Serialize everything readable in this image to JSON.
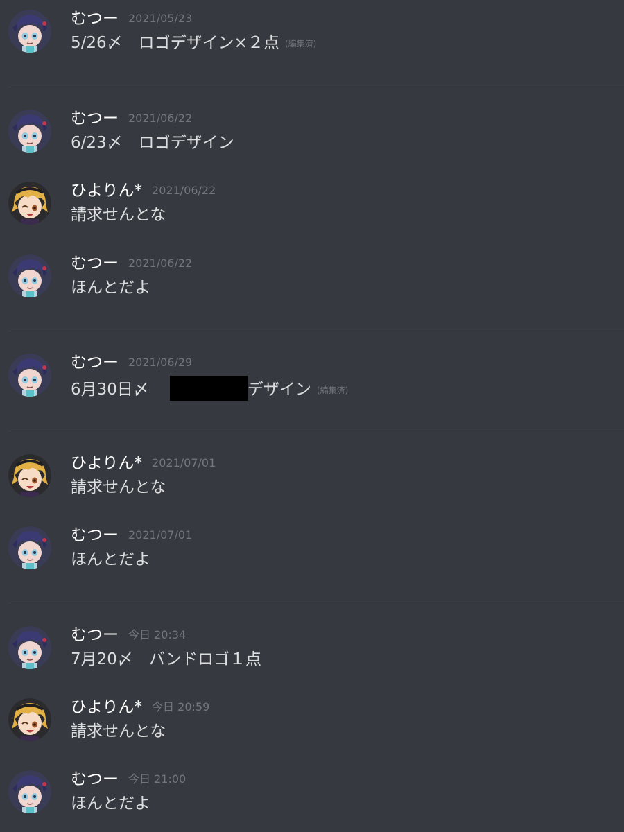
{
  "users": {
    "mutsu": "むつー",
    "hiyorin": "ひよりん*"
  },
  "labels": {
    "edited": "(編集済)"
  },
  "messages": [
    {
      "user": "むつー",
      "time": "2021/05/23",
      "text": "5/26〆　ロゴデザイン×２点",
      "edited": true
    },
    {
      "user": "むつー",
      "time": "2021/06/22",
      "text": "6/23〆　ロゴデザイン",
      "edited": false
    },
    {
      "user": "ひよりん*",
      "time": "2021/06/22",
      "text": "請求せんとな",
      "edited": false
    },
    {
      "user": "むつー",
      "time": "2021/06/22",
      "text": "ほんとだよ",
      "edited": false
    },
    {
      "user": "むつー",
      "time": "2021/06/29",
      "text_before": "6月30日〆",
      "text_after": "デザイン",
      "edited": true
    },
    {
      "user": "ひよりん*",
      "time": "2021/07/01",
      "text": "請求せんとな",
      "edited": false
    },
    {
      "user": "むつー",
      "time": "2021/07/01",
      "text": "ほんとだよ",
      "edited": false
    },
    {
      "user": "むつー",
      "time": "今日 20:34",
      "text": "7月20〆　バンドロゴ１点",
      "edited": false
    },
    {
      "user": "ひよりん*",
      "time": "今日 20:59",
      "text": "請求せんとな",
      "edited": false
    },
    {
      "user": "むつー",
      "time": "今日 21:00",
      "text": "ほんとだよ",
      "edited": false
    }
  ]
}
